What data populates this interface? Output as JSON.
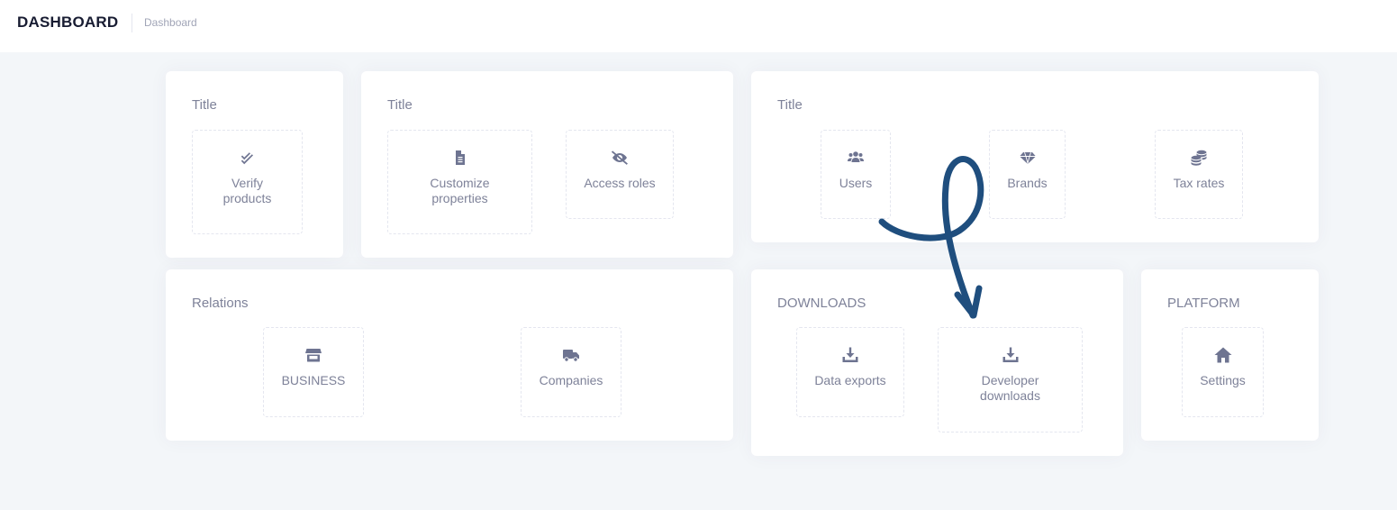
{
  "header": {
    "app_title": "DASHBOARD",
    "breadcrumb": "Dashboard"
  },
  "cards": {
    "verify": {
      "title": "Title",
      "tiles": [
        {
          "label": "Verify\nproducts",
          "icon": "double-check-icon"
        }
      ]
    },
    "properties": {
      "title": "Title",
      "tiles": [
        {
          "label": "Customize\nproperties",
          "icon": "document-icon"
        },
        {
          "label": "Access roles",
          "icon": "eye-slash-icon"
        }
      ]
    },
    "catalog": {
      "title": "Title",
      "tiles": [
        {
          "label": "Users",
          "icon": "users-icon"
        },
        {
          "label": "Brands",
          "icon": "gem-icon"
        },
        {
          "label": "Tax rates",
          "icon": "coins-icon"
        }
      ]
    },
    "relations": {
      "title": "Relations",
      "tiles": [
        {
          "label": "BUSINESS",
          "icon": "store-icon"
        },
        {
          "label": "Companies",
          "icon": "truck-icon"
        }
      ]
    },
    "downloads": {
      "title": "DOWNLOADS",
      "tiles": [
        {
          "label": "Data exports",
          "icon": "download-icon"
        },
        {
          "label": "Developer\ndownloads",
          "icon": "download-icon"
        }
      ]
    },
    "platform": {
      "title": "PLATFORM",
      "tiles": [
        {
          "label": "Settings",
          "icon": "home-icon"
        }
      ]
    }
  },
  "colors": {
    "background": "#f3f6f9",
    "card": "#ffffff",
    "text": "#7e8299",
    "icon": "#6e7491",
    "annotation_arrow": "#1f4e7e"
  }
}
